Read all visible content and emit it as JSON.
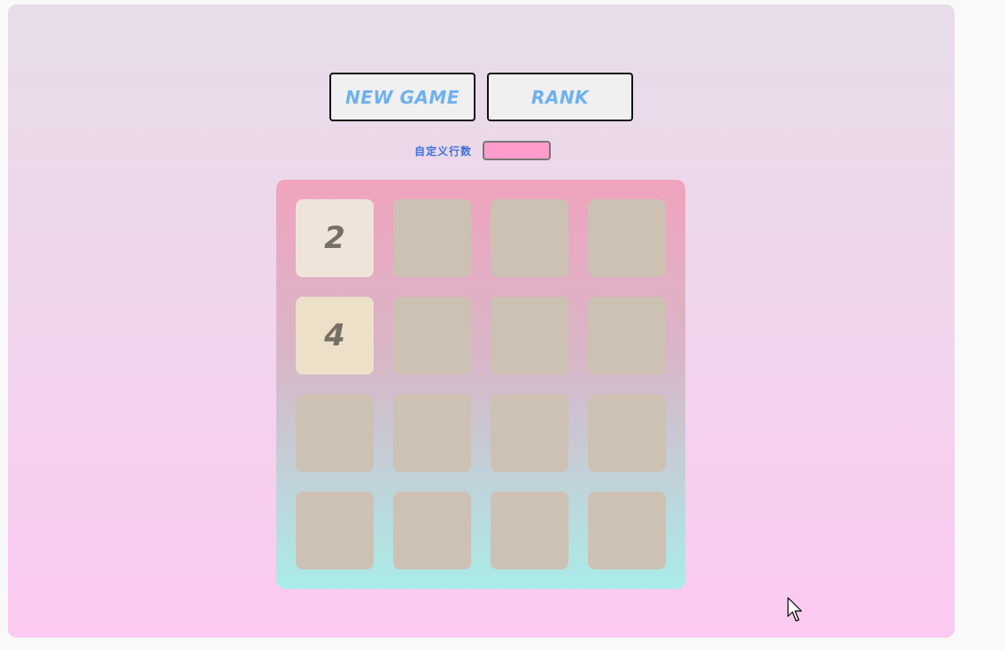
{
  "toolbar": {
    "new_game_label": "NEW GAME",
    "rank_label": "RANK"
  },
  "rows_setting": {
    "label": "自定义行数",
    "value": ""
  },
  "board": {
    "size": 4,
    "tiles": [
      [
        2,
        0,
        0,
        0
      ],
      [
        4,
        0,
        0,
        0
      ],
      [
        0,
        0,
        0,
        0
      ],
      [
        0,
        0,
        0,
        0
      ]
    ]
  },
  "colors": {
    "empty_cell": "#cdc1b4",
    "tile_2": "#eee4da",
    "tile_4": "#ede0c8",
    "tile_text": "#776e65",
    "button_text": "#6fb0f0",
    "label_text": "#3d72d8",
    "input_bg": "#ff9ccb"
  }
}
